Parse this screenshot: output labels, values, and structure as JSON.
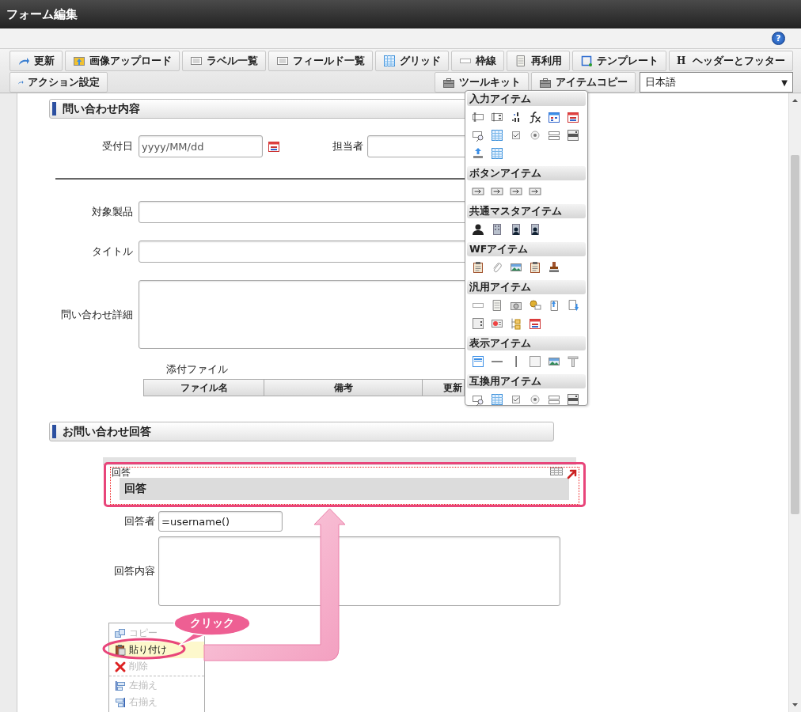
{
  "window": {
    "title": "フォーム編集",
    "help": "?"
  },
  "toolbar": {
    "tabs": [
      {
        "label": "更新"
      },
      {
        "label": "画像アップロード"
      },
      {
        "label": "ラベル一覧"
      },
      {
        "label": "フィールド一覧"
      },
      {
        "label": "グリッド"
      },
      {
        "label": "枠線"
      },
      {
        "label": "再利用"
      },
      {
        "label": "テンプレート"
      },
      {
        "label": "ヘッダーとフッター",
        "icon_text": "H"
      }
    ],
    "action_button": "アクション設定",
    "toolkit_button": "ツールキット",
    "copy_button": "アイテムコピー",
    "language": {
      "value": "日本語",
      "arrow": "▼"
    }
  },
  "inquiry_section": {
    "title": "問い合わせ内容",
    "date_label": "受付日",
    "date_placeholder": "yyyy/MM/dd",
    "assignee_label": "担当者",
    "product_label": "対象製品",
    "title_label": "タイトル",
    "detail_label": "問い合わせ詳細",
    "attachment_label": "添付ファイル",
    "attachment_columns": [
      "ファイル名",
      "備考",
      "更新"
    ]
  },
  "answer_section": {
    "title": "お問い合わせ回答",
    "item_label": "回答",
    "item_heading": "回答",
    "responder_label": "回答者",
    "responder_value": "=username()",
    "content_label": "回答内容"
  },
  "toolkit_popup": {
    "sections": [
      {
        "title": "入力アイテム"
      },
      {
        "title": "ボタンアイテム"
      },
      {
        "title": "共通マスタアイテム"
      },
      {
        "title": "WFアイテム"
      },
      {
        "title": "汎用アイテム"
      },
      {
        "title": "表示アイテム"
      },
      {
        "title": "互換用アイテム"
      }
    ]
  },
  "context_menu": {
    "items": [
      {
        "kind": "item",
        "label": "コピー",
        "disabled": true,
        "selected": false
      },
      {
        "kind": "item",
        "label": "貼り付け",
        "disabled": false,
        "selected": true
      },
      {
        "kind": "item",
        "label": "削除",
        "disabled": true,
        "selected": false
      },
      {
        "kind": "separator"
      },
      {
        "kind": "item",
        "label": "左揃え",
        "disabled": true,
        "selected": false
      },
      {
        "kind": "item",
        "label": "右揃え",
        "disabled": true,
        "selected": false
      }
    ]
  },
  "callout": {
    "text": "クリック"
  }
}
